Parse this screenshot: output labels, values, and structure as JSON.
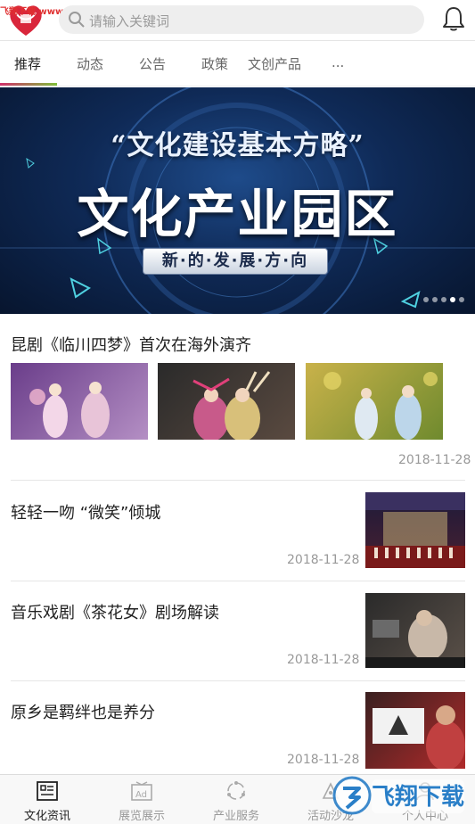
{
  "watermark_top": "飞翔下载 www.FXXZ.com",
  "search": {
    "placeholder": "请输入关键词"
  },
  "tabs": [
    {
      "label": "推荐"
    },
    {
      "label": "动态"
    },
    {
      "label": "公告"
    },
    {
      "label": "政策"
    },
    {
      "label": "文创产品"
    },
    {
      "label": "..."
    }
  ],
  "banner": {
    "quote": "“文化建设基本方略”",
    "main": "文化产业园区",
    "pill": "新·的·发·展·方·向",
    "slide_count": 5,
    "active_slide_index": 3
  },
  "news": [
    {
      "title": "昆剧《临川四梦》首次在海外演齐",
      "date": "2018-11-28"
    },
    {
      "title": "轻轻一吻 “微笑”倾城",
      "date": "2018-11-28"
    },
    {
      "title": "音乐戏剧《茶花女》剧场解读",
      "date": "2018-11-28"
    },
    {
      "title": "原乡是羁绊也是养分",
      "date": "2018-11-28"
    }
  ],
  "bottom_nav": [
    {
      "label": "文化资讯",
      "icon": "news-icon"
    },
    {
      "label": "展览展示",
      "icon": "gallery-icon"
    },
    {
      "label": "产业服务",
      "icon": "service-icon"
    },
    {
      "label": "活动沙龙",
      "icon": "event-icon"
    },
    {
      "label": "个人中心",
      "icon": "user-icon"
    }
  ],
  "watermark_bottom": "飞翔下载",
  "colors": {
    "accent_pink": "#d0306a",
    "accent_green": "#7fbf3a",
    "banner_bg": "#0f2a57"
  }
}
